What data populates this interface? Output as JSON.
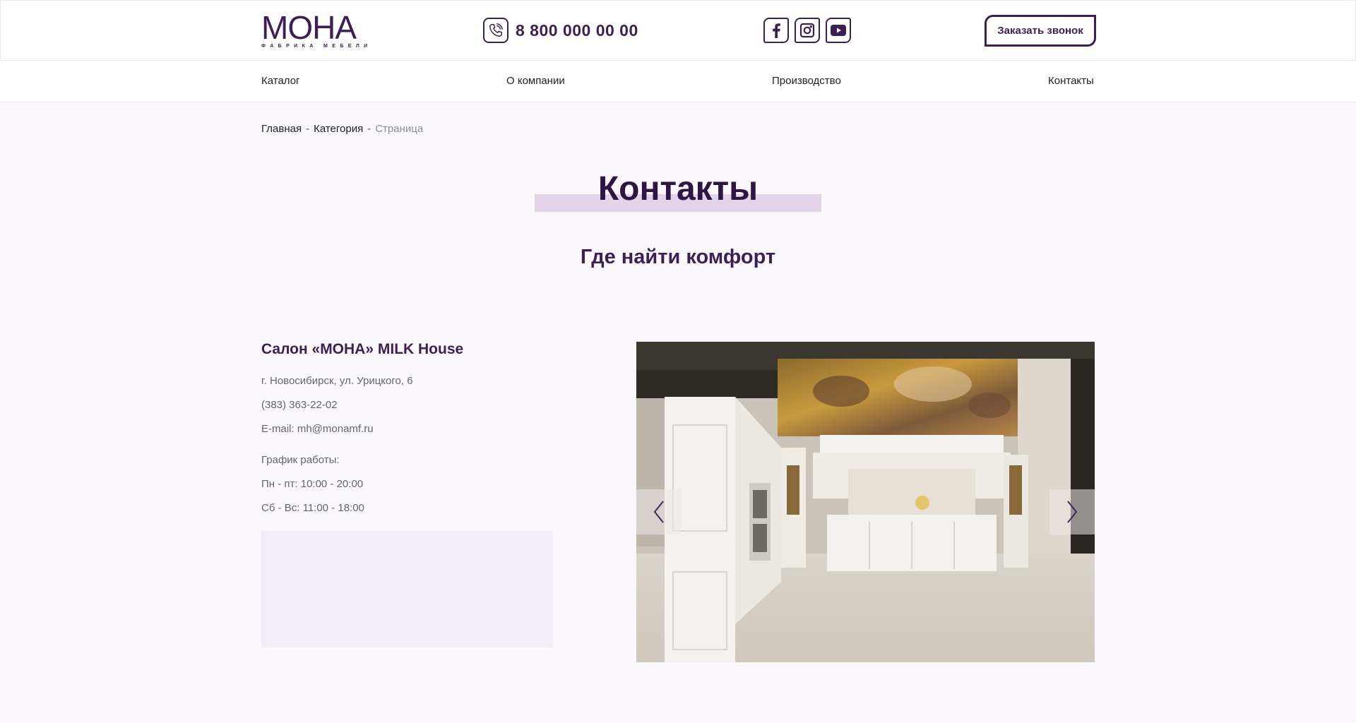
{
  "header": {
    "logo_main": "МОНА",
    "logo_sub": "ФАБРИКА МЕБЕЛИ",
    "phone": "8 800 000 00 00",
    "phone_icon": "phone-icon",
    "socials": [
      {
        "name": "facebook",
        "icon": "facebook-icon"
      },
      {
        "name": "instagram",
        "icon": "instagram-icon"
      },
      {
        "name": "youtube",
        "icon": "youtube-icon"
      }
    ],
    "callback_label": "Заказать звонок"
  },
  "nav": {
    "items": [
      {
        "label": "Каталог"
      },
      {
        "label": "О компании"
      },
      {
        "label": "Производство"
      },
      {
        "label": "Контакты"
      }
    ]
  },
  "breadcrumb": {
    "home": "Главная",
    "category": "Категория",
    "current": "Страница",
    "separator": "-"
  },
  "main": {
    "title": "Контакты",
    "subtitle": "Где найти комфорт"
  },
  "salon": {
    "name": "Салон «МОНА» MILK House",
    "address": "г. Новосибирск, ул. Урицкого, 6",
    "phone": "(383) 363-22-02",
    "email": "E-mail: mh@monamf.ru",
    "schedule_label": "График работы:",
    "weekdays": "Пн - пт: 10:00 - 20:00",
    "weekend": "Сб - Вс: 11:00 - 18:00"
  },
  "slider": {
    "prev_icon": "chevron-left-icon",
    "next_icon": "chevron-right-icon"
  },
  "colors": {
    "brand": "#3d1f55",
    "title_highlight": "#e2d3ea",
    "background": "#fbf8fd",
    "map_placeholder": "#f2edf6"
  }
}
